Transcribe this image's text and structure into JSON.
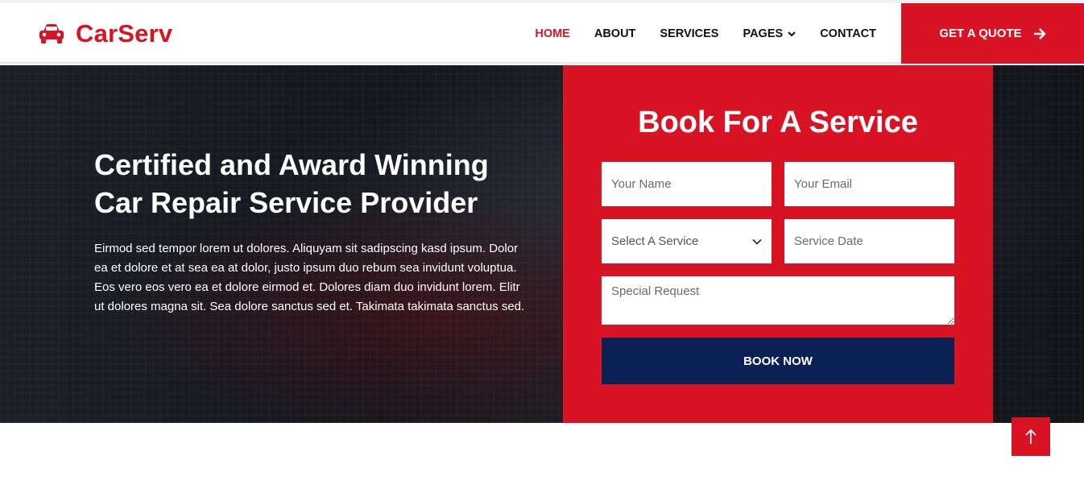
{
  "brand": {
    "name": "CarServ",
    "icon": "car-icon",
    "color": "#D81324"
  },
  "nav": {
    "items": [
      {
        "label": "HOME",
        "active": true
      },
      {
        "label": "ABOUT",
        "active": false
      },
      {
        "label": "SERVICES",
        "active": false
      },
      {
        "label": "PAGES",
        "active": false,
        "has_dropdown": true
      },
      {
        "label": "CONTACT",
        "active": false
      }
    ],
    "quote_button": "GET A QUOTE",
    "quote_icon": "arrow-right-icon"
  },
  "hero": {
    "title_line1": "Certified and Award Winning",
    "title_line2": "Car Repair Service Provider",
    "text": "Eirmod sed tempor lorem ut dolores. Aliquyam sit sadipscing kasd ipsum. Dolor ea et dolore et at sea ea at dolor, justo ipsum duo rebum sea invidunt voluptua. Eos vero eos vero ea et dolore eirmod et. Dolores diam duo invidunt lorem. Elitr ut dolores magna sit. Sea dolore sanctus sed et. Takimata takimata sanctus sed."
  },
  "booking": {
    "title": "Book For A Service",
    "name_placeholder": "Your Name",
    "email_placeholder": "Your Email",
    "service_selected": "Select A Service",
    "date_placeholder": "Service Date",
    "request_placeholder": "Special Request",
    "submit_label": "BOOK NOW"
  },
  "colors": {
    "accent": "#D81324",
    "dark": "#0B2154"
  },
  "back_to_top_icon": "arrow-up-icon"
}
